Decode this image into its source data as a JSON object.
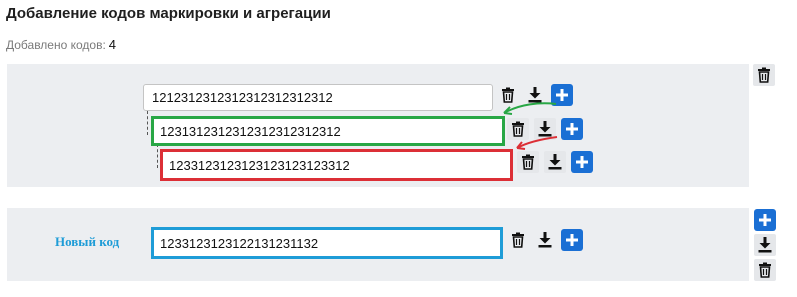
{
  "header": {
    "title": "Добавление кодов маркировки и агрегации",
    "count_label": "Добавлено кодов:",
    "count_value": "4"
  },
  "tree": {
    "level1_value": "1212312312312312312312312",
    "level2_value": "1231312312312312312312312",
    "level3_value": "1233123123123123123123312"
  },
  "new_code": {
    "label": "Новый код",
    "value": "1233123123122131231132"
  },
  "colors": {
    "panel_bg": "#eceef1",
    "accent_blue": "#1a6fd4",
    "highlight_green": "#28a745",
    "highlight_red": "#dc2f36",
    "highlight_blue": "#1e9cd7"
  },
  "icons": {
    "delete": "trash-icon",
    "download": "download-icon",
    "add": "plus-icon"
  }
}
